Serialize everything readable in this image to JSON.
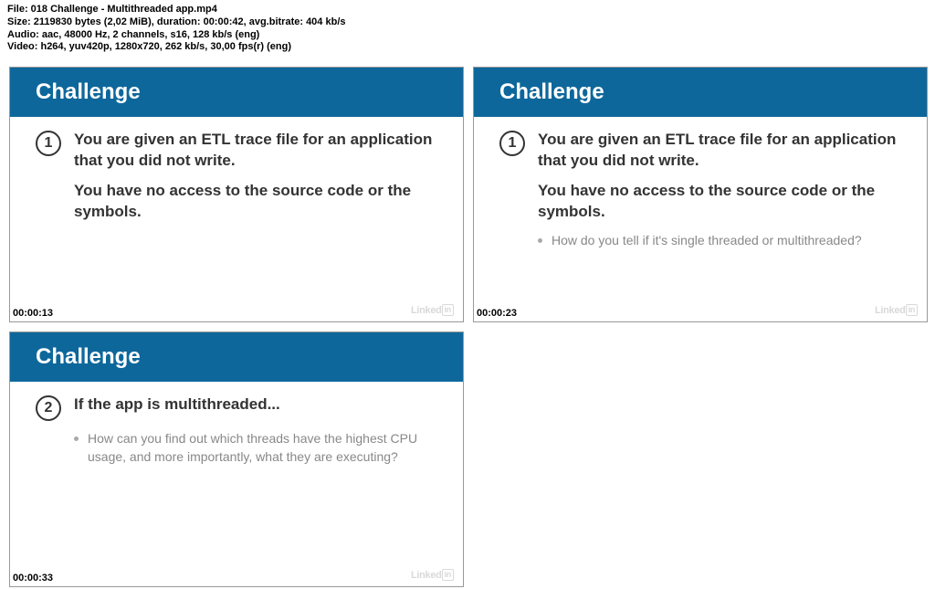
{
  "meta": {
    "file": "File: 018 Challenge - Multithreaded app.mp4",
    "size": "Size: 2119830 bytes (2,02 MiB), duration: 00:00:42, avg.bitrate: 404 kb/s",
    "audio": "Audio: aac, 48000 Hz, 2 channels, s16, 128 kb/s (eng)",
    "video": "Video: h264, yuv420p, 1280x720, 262 kb/s, 30,00 fps(r) (eng)"
  },
  "slides": [
    {
      "header": "Challenge",
      "number": "1",
      "lead": "You are given an ETL trace file for an application that you did not write.",
      "para": "You have no access to the source code or the symbols.",
      "bullet": null,
      "timestamp": "00:00:13"
    },
    {
      "header": "Challenge",
      "number": "1",
      "lead": "You are given an ETL trace file for an application that you did not write.",
      "para": "You have no access to the source code or the symbols.",
      "bullet": "How do you tell if it's single threaded or multithreaded?",
      "timestamp": "00:00:23"
    },
    {
      "header": "Challenge",
      "number": "2",
      "lead": "If the app is multithreaded...",
      "para": null,
      "bullet": "How can you find out which threads have the highest CPU usage, and more importantly, what they are executing?",
      "timestamp": "00:00:33"
    }
  ],
  "watermark": {
    "text": "Linked",
    "box": "in"
  }
}
